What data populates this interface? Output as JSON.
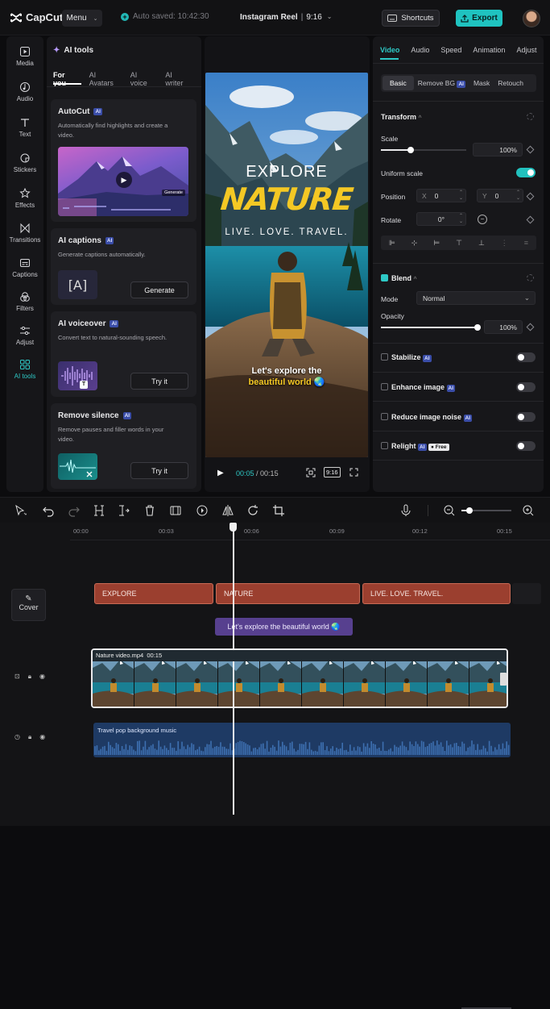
{
  "app": {
    "name": "CapCut",
    "menu_label": "Menu",
    "autosave": "Auto saved: 10:42:30",
    "project_title": "Instagram Reel",
    "aspect": "9:16",
    "shortcuts_label": "Shortcuts",
    "export_label": "Export",
    "accent": "#2ec9c6"
  },
  "rail": [
    {
      "label": "Media",
      "icon": "media-icon"
    },
    {
      "label": "Audio",
      "icon": "audio-icon"
    },
    {
      "label": "Text",
      "icon": "text-icon"
    },
    {
      "label": "Stickers",
      "icon": "stickers-icon"
    },
    {
      "label": "Effects",
      "icon": "effects-icon"
    },
    {
      "label": "Transitions",
      "icon": "transitions-icon"
    },
    {
      "label": "Captions",
      "icon": "captions-icon"
    },
    {
      "label": "Filters",
      "icon": "filters-icon"
    },
    {
      "label": "Adjust",
      "icon": "adjust-icon"
    },
    {
      "label": "AI tools",
      "icon": "ai-tools-icon",
      "active": true
    }
  ],
  "ai_panel": {
    "title": "AI tools",
    "tabs": [
      "For you",
      "AI Avatars",
      "AI voice",
      "AI writer"
    ],
    "badge": "AI",
    "cards": [
      {
        "title": "AutoCut",
        "desc": "Automatically find highlights and create a video.",
        "thumb_label": "Generate"
      },
      {
        "title": "AI captions",
        "desc": "Generate captions automatically.",
        "button": "Generate",
        "icon_text": "A"
      },
      {
        "title": "AI voiceover",
        "desc": "Convert text to natural-sounding speech.",
        "button": "Try it",
        "icon_text": "T"
      },
      {
        "title": "Remove silence",
        "desc": "Remove pauses and filler words in your video.",
        "button": "Try it"
      }
    ]
  },
  "preview": {
    "line1": "EXPLORE",
    "line2": "NATURE",
    "line3": "LIVE. LOVE. TRAVEL.",
    "caption_a": "Let's explore the",
    "caption_b": "beautiful world",
    "caption_emoji": "🌏",
    "time_current": "00:05",
    "time_sep": " / ",
    "time_total": "00:15",
    "ratio": "9:16"
  },
  "props": {
    "tabs": [
      "Video",
      "Audio",
      "Speed",
      "Animation",
      "Adjust"
    ],
    "subtabs": [
      "Basic",
      "Remove BG",
      "Mask",
      "Retouch"
    ],
    "transform_title": "Transform",
    "scale_label": "Scale",
    "scale_value": "100%",
    "scale_level": 1.0,
    "uniform_label": "Uniform scale",
    "position_label": "Position",
    "pos_x_label": "X",
    "pos_x": "0",
    "pos_y_label": "Y",
    "pos_y": "0",
    "rotate_label": "Rotate",
    "rotate_value": "0°",
    "blend_title": "Blend",
    "mode_label": "Mode",
    "mode_value": "Normal",
    "opacity_label": "Opacity",
    "opacity_value": "100%",
    "opacity_level": 1.0,
    "stabilize": "Stabilize",
    "enhance": "Enhance image",
    "noise": "Reduce image noise",
    "relight": "Relight",
    "free_badge": "Free",
    "ai_badge": "AI"
  },
  "timeline": {
    "ticks": [
      "00:00",
      "00:03",
      "00:06",
      "00:09",
      "00:12",
      "00:15"
    ],
    "cover_label": "Cover",
    "text_clips": [
      "EXPLORE",
      "NATURE",
      "LIVE. LOVE. TRAVEL."
    ],
    "caption_clip": "Let's explore the beautiful world 🌏",
    "video_clip_name": "Nature video.mp4",
    "video_clip_duration": "00:15",
    "audio_clip_name": "Travel pop background music",
    "playhead_time": 5.6
  }
}
